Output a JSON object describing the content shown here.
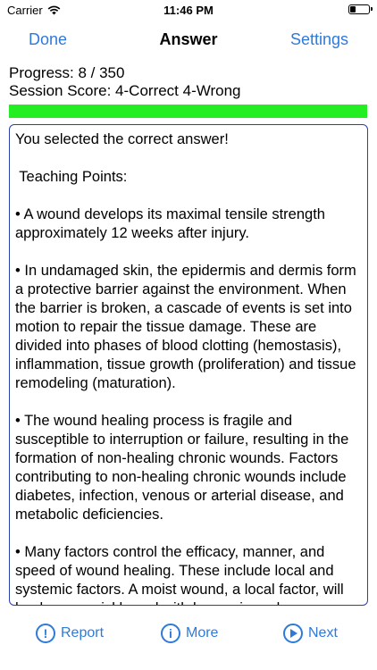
{
  "status": {
    "carrier": "Carrier",
    "time": "11:46 PM"
  },
  "nav": {
    "left": "Done",
    "title": "Answer",
    "right": "Settings"
  },
  "session": {
    "progress": "Progress: 8 / 350",
    "score": "Session Score: 4-Correct 4-Wrong",
    "bar_fill_fraction": 1.0,
    "bar_color": "#22ee22"
  },
  "content": {
    "result": "You selected the correct answer!",
    "heading": " Teaching Points:",
    "points": [
      "• A wound develops its maximal tensile strength approximately 12 weeks after injury.",
      "• In undamaged skin, the epidermis and dermis form a protective barrier against the environment. When the barrier is broken, a cascade of events is set into motion to repair the tissue damage. These are divided into phases of blood clotting (hemostasis), inflammation, tissue growth (proliferation) and tissue remodeling (maturation).",
      "• The wound healing process is fragile and susceptible to interruption or failure, resulting in the formation of non-healing chronic wounds. Factors contributing to non-healing chronic wounds include diabetes, infection, venous or arterial disease, and metabolic deficiencies.",
      "• Many factors control the efficacy, manner, and speed of wound healing. These include local and systemic factors. A moist wound, a local factor, will heal more quickly and with less pain and"
    ]
  },
  "toolbar": {
    "report": "Report",
    "more": "More",
    "next": "Next"
  },
  "colors": {
    "accent": "#2f7ad9",
    "border": "#2d3fa8"
  }
}
